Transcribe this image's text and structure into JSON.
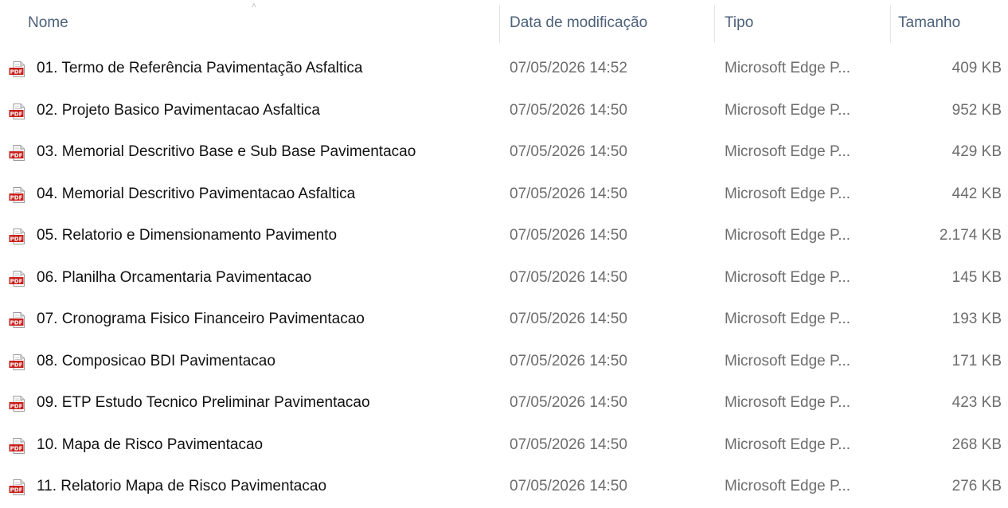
{
  "columns": {
    "name": "Nome",
    "date": "Data de modificação",
    "type": "Tipo",
    "size": "Tamanho"
  },
  "colors": {
    "pdf_icon_red": "#c9201c",
    "header_text": "#4c607a",
    "secondary_text": "#6d6d6d"
  },
  "file_icon": "pdf-file-icon",
  "files": [
    {
      "name": "01. Termo de Referência Pavimentação Asfaltica",
      "date": "07/05/2026 14:52",
      "type": "Microsoft Edge P...",
      "size": "409 KB"
    },
    {
      "name": "02. Projeto Basico Pavimentacao Asfaltica",
      "date": "07/05/2026 14:50",
      "type": "Microsoft Edge P...",
      "size": "952 KB"
    },
    {
      "name": "03. Memorial Descritivo Base e Sub Base Pavimentacao",
      "date": "07/05/2026 14:50",
      "type": "Microsoft Edge P...",
      "size": "429 KB"
    },
    {
      "name": "04. Memorial Descritivo Pavimentacao Asfaltica",
      "date": "07/05/2026 14:50",
      "type": "Microsoft Edge P...",
      "size": "442 KB"
    },
    {
      "name": "05. Relatorio e Dimensionamento Pavimento",
      "date": "07/05/2026 14:50",
      "type": "Microsoft Edge P...",
      "size": "2.174 KB"
    },
    {
      "name": "06. Planilha Orcamentaria Pavimentacao",
      "date": "07/05/2026 14:50",
      "type": "Microsoft Edge P...",
      "size": "145 KB"
    },
    {
      "name": "07. Cronograma Fisico Financeiro Pavimentacao",
      "date": "07/05/2026 14:50",
      "type": "Microsoft Edge P...",
      "size": "193 KB"
    },
    {
      "name": "08. Composicao BDI Pavimentacao",
      "date": "07/05/2026 14:50",
      "type": "Microsoft Edge P...",
      "size": "171 KB"
    },
    {
      "name": "09. ETP Estudo Tecnico Preliminar Pavimentacao",
      "date": "07/05/2026 14:50",
      "type": "Microsoft Edge P...",
      "size": "423 KB"
    },
    {
      "name": "10. Mapa de Risco Pavimentacao",
      "date": "07/05/2026 14:50",
      "type": "Microsoft Edge P...",
      "size": "268 KB"
    },
    {
      "name": "11. Relatorio Mapa de Risco Pavimentacao",
      "date": "07/05/2026 14:50",
      "type": "Microsoft Edge P...",
      "size": "276 KB"
    }
  ]
}
